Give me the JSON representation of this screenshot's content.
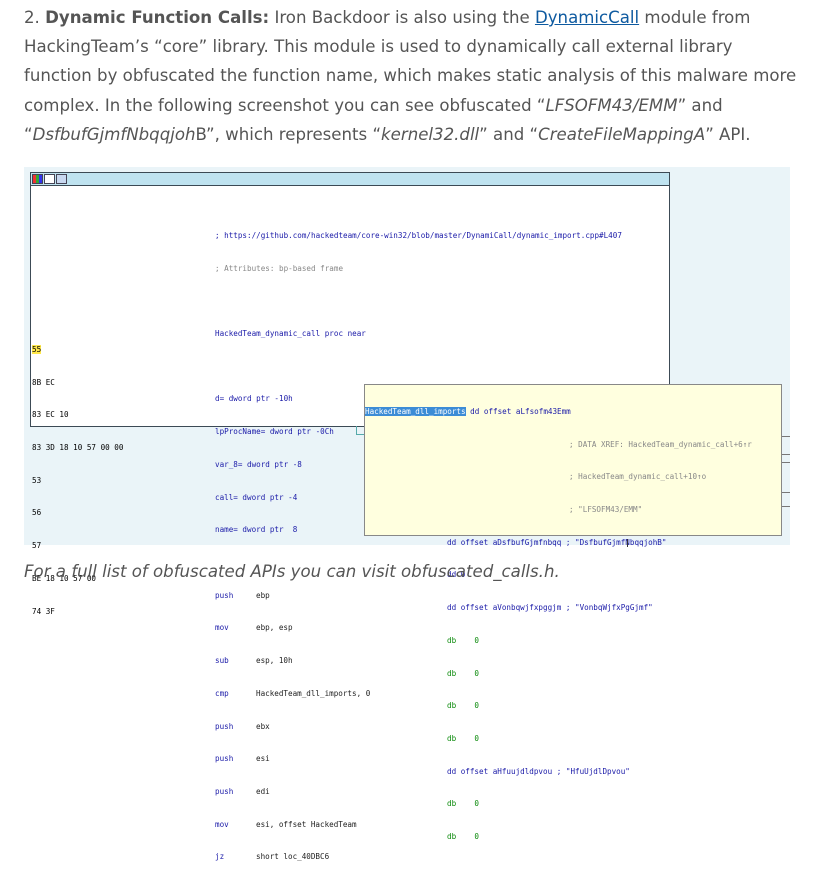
{
  "paragraph": {
    "number": "2.",
    "lead": "Dynamic Function Calls:",
    "t1": " Iron Backdoor is also using the ",
    "link": "DynamicCall",
    "t2": " module from HackingTeam’s “core” library. This module is used to dynamically call external library function by obfuscated the function name, which makes static analysis of this malware more complex. In the following screenshot you can see obfuscated “",
    "i1": "LFSOFM43/EMM",
    "t3": "” and “",
    "i2": "DsfbufGjmfNbqqjoh",
    "t4": "B”, which represents “",
    "i3": "kernel32.dll",
    "t5": "” and “",
    "i4": "CreateFileMappingA",
    "t6": "” API."
  },
  "disasm": {
    "comment_url": "; https://github.com/hackedteam/core-win32/blob/master/DynamiCall/dynamic_import.cpp#L407",
    "comment_attr": "; Attributes: bp-based frame",
    "proc": "HackedTeam_dynamic_call proc near",
    "locals": [
      "d= dword ptr -10h",
      "lpProcName= dword ptr -0Ch",
      "var_8= dword ptr -8",
      "call= dword ptr -4",
      "name= dword ptr  8"
    ],
    "bytes": [
      "55",
      "8B EC",
      "83 EC 10",
      "83 3D 18 10 57 00 00",
      "53",
      "56",
      "57",
      "BE 18 10 57 00",
      "74 3F"
    ],
    "mnemonics": [
      "push",
      "mov",
      "sub",
      "cmp",
      "push",
      "push",
      "push",
      "mov",
      "jz"
    ],
    "operands": [
      "ebp",
      "ebp, esp",
      "esp, 10h",
      "HackedTeam_dll_imports, 0",
      "ebx",
      "esi",
      "edi",
      "esi, offset HackedTeam",
      "short loc_40DBC6"
    ]
  },
  "tooltip": {
    "label": "HackedTeam_dll_imports",
    "head": " dd offset aLfsofm43Emm",
    "xref1": "; DATA XREF: HackedTeam_dynamic_call+6↑r",
    "xref2": "; HackedTeam_dynamic_call+10↑o",
    "str1": "; \"LFSOFM43/EMM\"",
    "rows": [
      "dd offset aDsfbufGjmfnbqq ; \"DsfbufGjmfNbqqjohB\"",
      "dd 0",
      "dd offset aVonbqwjfxpggjm ; \"VonbqWjfxPgGjmf\"",
      "db    0",
      "db    0",
      "db    0",
      "db    0",
      "dd offset aHfuujdldpvou ; \"HfuUjdlDpvou\"",
      "db    0",
      "db    0"
    ]
  },
  "caption": "For a full list of obfuscated APIs you can visit obfuscated_calls.h.",
  "colors": {
    "link": "#0e5aa0",
    "highlight": "#ffe84a",
    "tooltip_bg": "#ffffdf",
    "titlebar": "#bfe3f0"
  }
}
